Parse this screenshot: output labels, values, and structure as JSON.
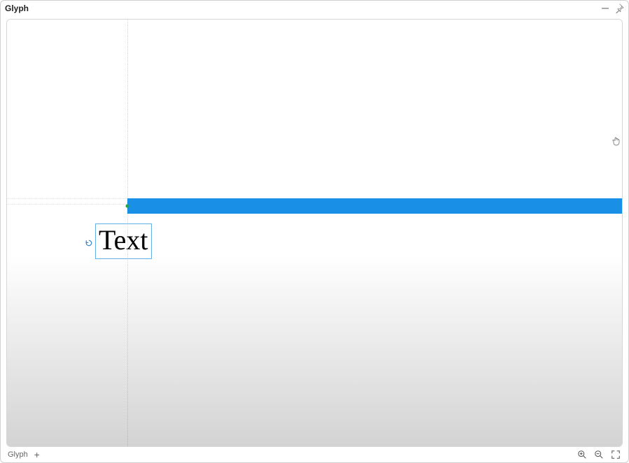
{
  "panel": {
    "title": "Glyph"
  },
  "canvas": {
    "text_object": {
      "value": "Text"
    },
    "blue_bar": {
      "color": "#1a8fe6"
    }
  },
  "statusbar": {
    "tab_label": "Glyph"
  }
}
